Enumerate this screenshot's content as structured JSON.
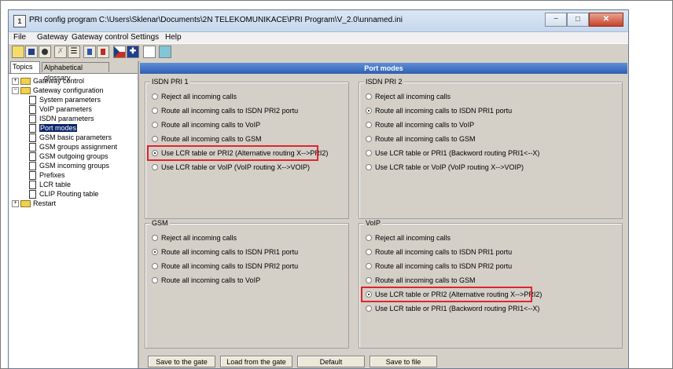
{
  "window": {
    "title": "PRI config program C:\\Users\\Sklenar\\Documents\\2N TELEKOMUNIKACE\\PRI Program\\V_2.0\\unnamed.ini",
    "app_icon": "1",
    "minimize": "−",
    "maximize": "□",
    "close": "✕"
  },
  "menu": [
    "File",
    "Gateway",
    "Gateway control",
    "Settings",
    "Help"
  ],
  "toolbar_icons": [
    "open-icon",
    "save-icon",
    "disk-icon",
    "disconnect-icon",
    "list-icon",
    "upload-icon",
    "download-icon",
    "czech-flag-icon",
    "uk-flag-icon",
    "about-icon",
    "book-icon"
  ],
  "tabs": {
    "topics": "Topics",
    "glossary": "Alphabetical glossary"
  },
  "tree": {
    "gateway_control": "Gateway control",
    "gateway_configuration": "Gateway configuration",
    "system_parameters": "System parameters",
    "voip_parameters": "VoIP parameters",
    "isdn_parameters": "ISDN parameters",
    "port_modes": "Port modes",
    "gsm_basic": "GSM basic parameters",
    "gsm_groups": "GSM groups assignment",
    "gsm_outgoing": "GSM outgoing groups",
    "gsm_incoming": "GSM incoming groups",
    "prefixes": "Prefixes",
    "lcr_table": "LCR table",
    "clip_routing": "CLIP Routing table",
    "restart": "Restart"
  },
  "panel": {
    "title": "Port modes"
  },
  "groups": {
    "isdn_pri1": {
      "label": "ISDN PRI 1",
      "options": [
        "Reject all incoming calls",
        "Route all incoming calls to ISDN PRI2 portu",
        "Route all incoming calls to VoIP",
        "Route all incoming calls to GSM",
        "Use LCR table or PRI2 (Alternative routing X-->PRI2)",
        "Use LCR table or VoIP (VoIP routing X-->VOIP)"
      ],
      "selected": 4
    },
    "isdn_pri2": {
      "label": "ISDN PRI 2",
      "options": [
        "Reject all incoming calls",
        "Route all incoming calls to ISDN PRI1 portu",
        "Route all incoming calls to VoIP",
        "Route all incoming calls to GSM",
        "Use LCR table or PRI1 (Backword routing PRI1<--X)",
        "Use LCR table or VoIP (VoIP routing X-->VOIP)"
      ],
      "selected": 1
    },
    "gsm": {
      "label": "GSM",
      "options": [
        "Reject all incoming calls",
        "Route all incoming calls to ISDN PRI1 portu",
        "Route all incoming calls to ISDN PRI2 portu",
        "Route all incoming calls to VoIP"
      ],
      "selected": 1
    },
    "voip": {
      "label": "VoIP",
      "options": [
        "Reject all incoming calls",
        "Route all incoming calls to ISDN PRI1 portu",
        "Route all incoming calls to ISDN PRI2 portu",
        "Route all incoming calls to GSM",
        "Use LCR table or PRI2 (Alternative routing X-->PRI2)",
        "Use LCR table or PRI1 (Backword routing PRI1<--X)"
      ],
      "selected": 4
    }
  },
  "buttons": {
    "save_gate": "Save to the gate",
    "load_gate": "Load from the gate",
    "default": "Default",
    "save_file": "Save to file"
  },
  "colors": {
    "highlight": "#e0252b",
    "panel_header": "#3f6fc0",
    "tree_selection": "#0a246a"
  }
}
